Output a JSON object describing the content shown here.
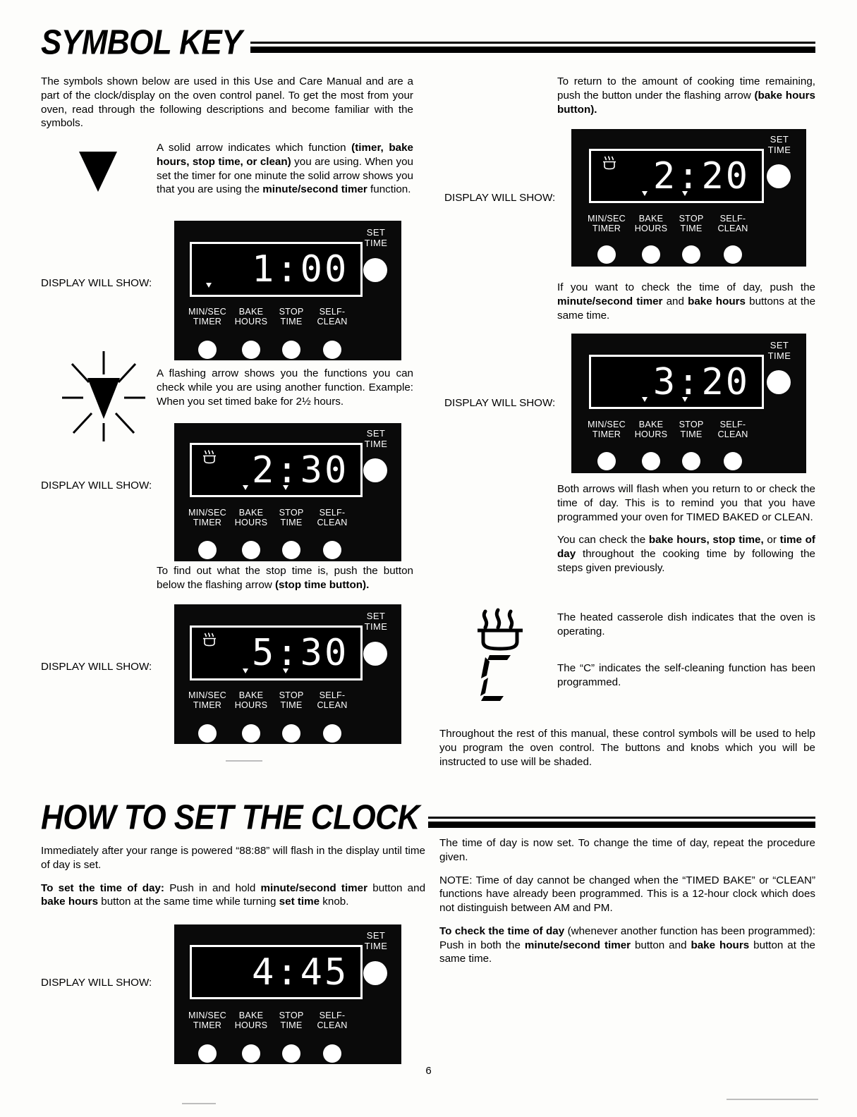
{
  "page": {
    "number": "6"
  },
  "sections": [
    {
      "title": "SYMBOL KEY"
    },
    {
      "title": "HOW TO SET THE CLOCK"
    }
  ],
  "labels": {
    "display_will_show": "DISPLAY WILL SHOW:"
  },
  "panel_common": {
    "set_time": "SET\nTIME",
    "functions": [
      "MIN/SEC\nTIMER",
      "BAKE\nHOURS",
      "STOP\nTIME",
      "SELF-\nCLEAN"
    ]
  },
  "symbol_key": {
    "intro": "The symbols shown below are used in this Use and Care Manual and are a part of the clock/display on the oven control panel. To get the most from your oven, read through the following descriptions and become familiar with the symbols.",
    "solid_arrow_desc_1": "A solid arrow indicates which function ",
    "solid_arrow_desc_bold_1": "(timer, bake hours, stop time, or clean)",
    "solid_arrow_desc_2": " you are using. When you set the timer for one minute the solid arrow shows you that you are using the ",
    "solid_arrow_desc_bold_2": "minute/second timer",
    "solid_arrow_desc_3": " function.",
    "flashing_arrow_desc": "A flashing arrow shows you the functions you can check while you are using another function. Example: When you set timed bake for 2½ hours.",
    "stop_time_desc_1": "To find out what the stop time is, push the button below the flashing arrow ",
    "stop_time_desc_bold": "(stop time button).",
    "return_time_desc_1": "To return to the amount of cooking time remaining, push the button under the flashing arrow ",
    "return_time_desc_bold": "(bake hours button).",
    "check_tod_desc_1": "If you want to check the time of day, push the ",
    "check_tod_bold_1": "minute/second timer",
    "check_tod_desc_2": " and ",
    "check_tod_bold_2": "bake hours",
    "check_tod_desc_3": " buttons at the same time.",
    "both_arrows_desc": "Both arrows will flash when you return to or check the time of day. This is to remind you that you have programmed your oven for TIMED BAKED or CLEAN.",
    "you_can_check_1": "You can check the ",
    "you_can_check_bold_1": "bake hours, stop time,",
    "you_can_check_2": " or ",
    "you_can_check_bold_2": "time of day",
    "you_can_check_3": " throughout the cooking time by following the steps given previously.",
    "casserole_desc": "The heated casserole dish indicates that the oven is operating.",
    "c_symbol_desc": "The “C” indicates the self-cleaning function has been programmed.",
    "throughout_desc": "Throughout the rest of this manual, these control symbols will be used to help you program the oven control. The buttons and knobs which you will be instructed to use will be shaded."
  },
  "set_clock": {
    "p1": "Immediately after your range is powered “88:88” will flash in the display until time of day is set.",
    "p2_bold": "To set the time of day:",
    "p2_a": " Push in and hold ",
    "p2_bold_2": "minute/second timer",
    "p2_b": " button and ",
    "p2_bold_3": "bake hours",
    "p2_c": " button at the same time while turning ",
    "p2_bold_4": "set time",
    "p2_d": " knob.",
    "r1": "The time of day is now set. To change the time of day, repeat the procedure given.",
    "r2": "NOTE: Time of day cannot be changed when the “TIMED BAKE” or “CLEAN” functions have already been programmed. This is a 12-hour clock which does not distinguish between AM and PM.",
    "r3_bold": "To check the time of day",
    "r3_a": " (whenever another function has been programmed): Push in both the ",
    "r3_bold_2": "minute/second timer",
    "r3_b": " button and ",
    "r3_bold_3": "bake hours",
    "r3_c": " button at the same time."
  },
  "panels": [
    {
      "id": "panel-1-00",
      "display_value": "1:00",
      "casserole": false,
      "markers": [
        0
      ],
      "shaded_buttons": [],
      "set_time_shaded": false
    },
    {
      "id": "panel-2-30",
      "display_value": "2:30",
      "casserole": true,
      "markers": [
        1,
        2
      ],
      "shaded_buttons": [],
      "set_time_shaded": false
    },
    {
      "id": "panel-5-30",
      "display_value": "5:30",
      "casserole": true,
      "markers": [
        1,
        2
      ],
      "shaded_buttons": [],
      "set_time_shaded": false
    },
    {
      "id": "panel-2-20",
      "display_value": "2:20",
      "casserole": true,
      "markers": [
        1,
        2
      ],
      "shaded_buttons": [],
      "set_time_shaded": false
    },
    {
      "id": "panel-3-20",
      "display_value": "3:20",
      "casserole": false,
      "markers": [
        1,
        2
      ],
      "shaded_buttons": [],
      "set_time_shaded": false
    },
    {
      "id": "panel-4-45",
      "display_value": "4:45",
      "casserole": false,
      "markers": [],
      "shaded_buttons": [
        0,
        1
      ],
      "set_time_shaded": true
    }
  ],
  "icons": {
    "solid_arrow": "solid-down-arrow",
    "flashing_arrow": "flashing-down-arrow",
    "casserole": "heated-casserole-dish",
    "c_letter": "segment-c-letter"
  }
}
